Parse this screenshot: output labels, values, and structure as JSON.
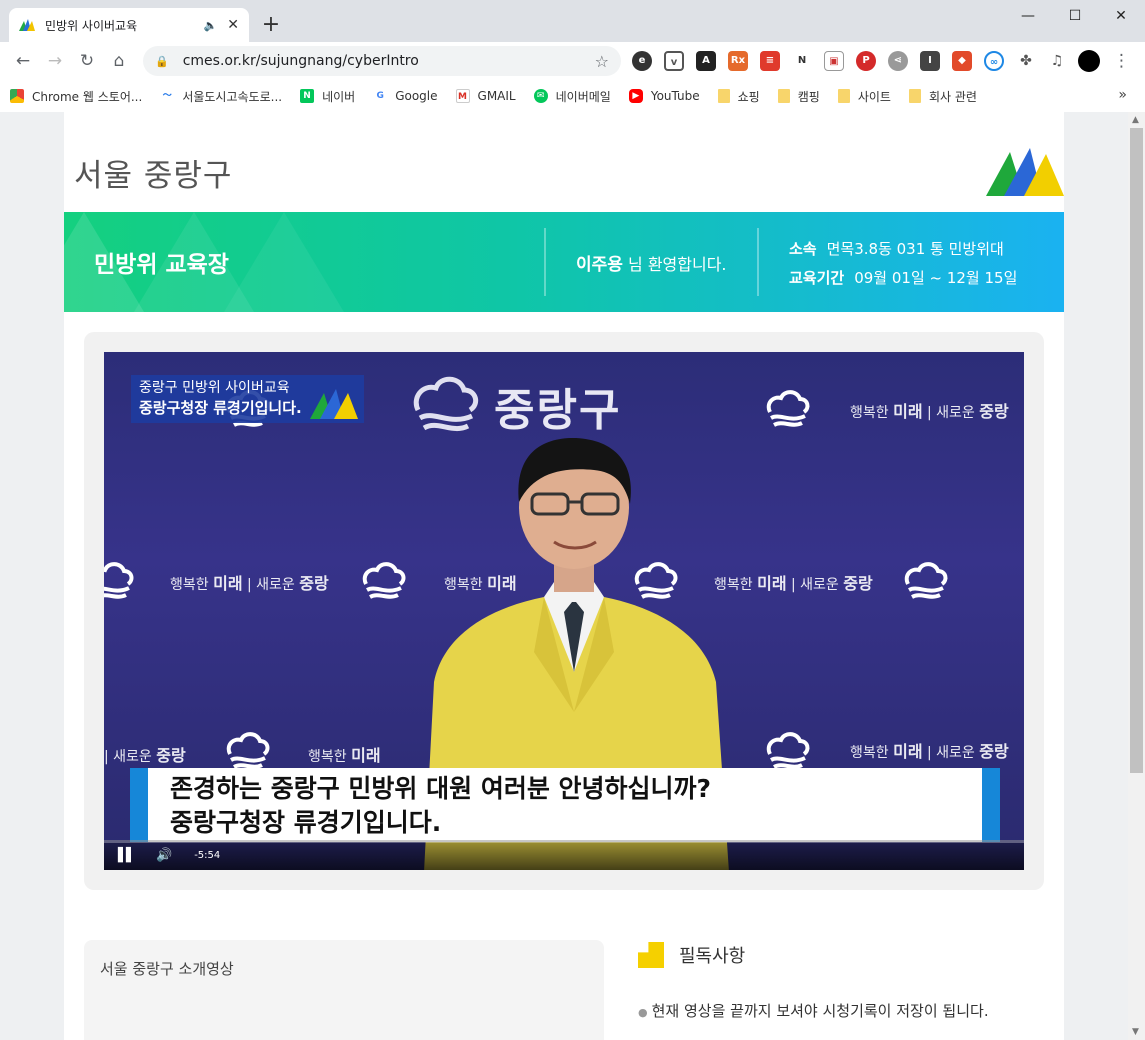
{
  "browser": {
    "tab_title": "민방위 사이버교육",
    "new_tab": "+",
    "url": "cmes.or.kr/sujungnang/cyberIntro",
    "bookmarks": [
      "Chrome 웹 스토어...",
      "서울도시고속도로...",
      "네이버",
      "Google",
      "GMAIL",
      "네이버메일",
      "YouTube",
      "쇼핑",
      "캠핑",
      "사이트",
      "회사 관련"
    ],
    "bookmarks_more": "»",
    "window_controls": {
      "minimize": "—",
      "maximize": "☐",
      "close": "✕"
    }
  },
  "header": {
    "title": "서울 중랑구"
  },
  "banner": {
    "section_title": "민방위 교육장",
    "user_name": "이주용",
    "welcome_suffix": " 님 환영합니다.",
    "affiliation_label": "소속",
    "affiliation_value": "면목3.8동 031 통 민방위대",
    "period_label": "교육기간",
    "period_value": "09월 01일 ~ 12월 15일"
  },
  "video": {
    "caption_line1": "중랑구 민방위 사이버교육",
    "caption_line2": "중랑구청장 류경기입니다.",
    "brand_text": "중랑구",
    "slogan_a": "행복한",
    "slogan_b": "미래",
    "slogan_c": "새로운",
    "slogan_d": "중랑",
    "subtitle_line1": "존경하는 중랑구 민방위 대원 여러분 안녕하십니까?",
    "subtitle_line2": "중랑구청장 류경기입니다.",
    "time_remaining": "-5:54"
  },
  "intro": {
    "title": "서울 중랑구 소개영상"
  },
  "notice": {
    "heading": "필독사항",
    "items": [
      "현재 영상을 끝까지 보셔야 시청기록이 저장이 됩니다."
    ]
  }
}
